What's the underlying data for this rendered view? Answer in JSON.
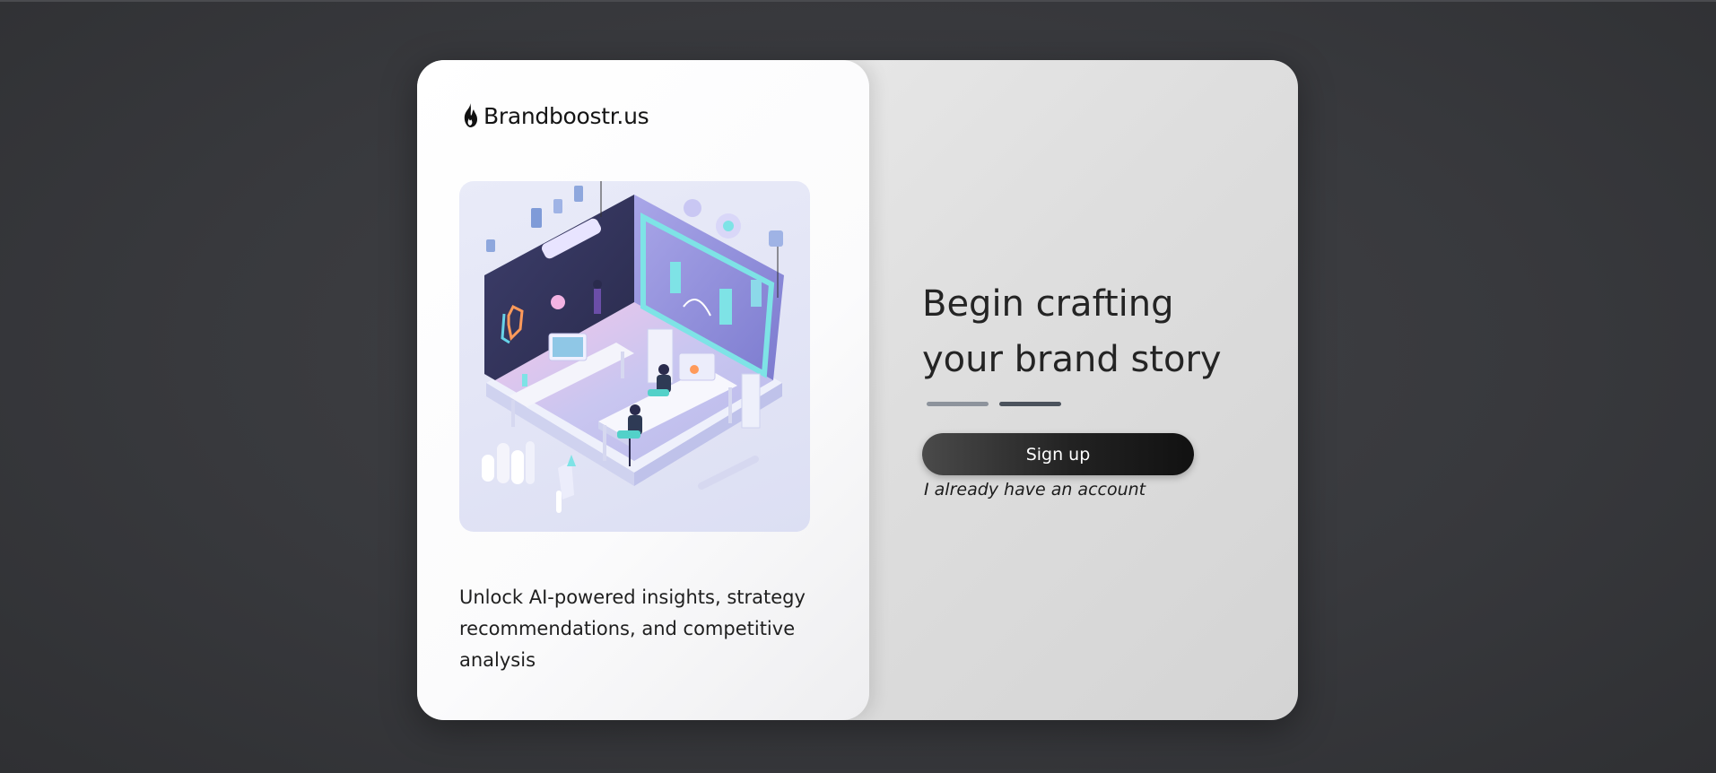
{
  "brand": {
    "name": "Brandboostr.us",
    "icon": "flame-icon"
  },
  "illustration": {
    "description_icon": "isometric-office-illustration"
  },
  "tagline": "Unlock AI-powered insights, strategy recommendations, and competitive analysis",
  "onboarding": {
    "headline_line1": "Begin crafting",
    "headline_line2": "your brand story",
    "steps_total": 2,
    "current_step": 2,
    "signup_label": "Sign up",
    "login_label": "I already have an account"
  },
  "colors": {
    "background": "#38393d",
    "card_right": "#dedede",
    "card_left": "#ffffff",
    "button": "#1f1f1f",
    "step_active": "#4b525c",
    "step_inactive": "#8d939c"
  }
}
